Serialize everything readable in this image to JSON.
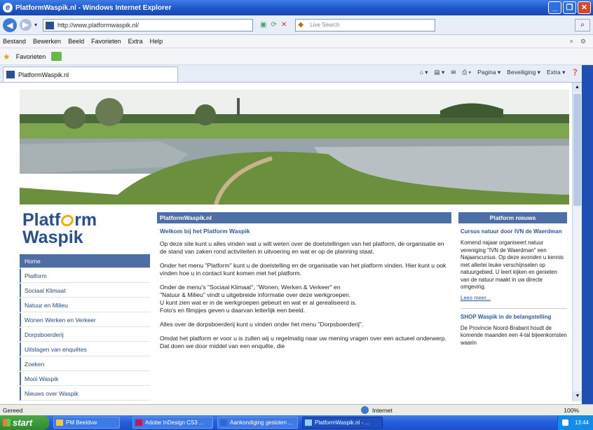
{
  "window": {
    "title": "PlatformWaspik.nl - Windows Internet Explorer",
    "buttons": [
      "_",
      "❐",
      "✕"
    ]
  },
  "address_bar": {
    "url": "http://www.platformwaspik.nl/",
    "search_placeholder": "Live Search"
  },
  "menu": [
    "Bestand",
    "Bewerken",
    "Beeld",
    "Favorieten",
    "Extra",
    "Help"
  ],
  "favorites_label": "Favorieten",
  "tab": {
    "label": "PlatformWaspik.nl"
  },
  "command_bar": [
    "Pagina ▾",
    "Beveiliging ▾",
    "Extra ▾"
  ],
  "site": {
    "logo": {
      "line1": "Platf",
      "line1b": "rm",
      "line2": "Waspik"
    },
    "nav": [
      {
        "label": "Home",
        "active": true
      },
      {
        "label": "Platform"
      },
      {
        "label": "Sociaal Klimaat"
      },
      {
        "label": "Natuur en Milieu"
      },
      {
        "label": "Wonen Werken en Verkeer"
      },
      {
        "label": "Dorpsboerderij"
      },
      {
        "label": "Uitslagen van enquêtes"
      },
      {
        "label": "Zoeken"
      },
      {
        "label": "Mooi Waspik"
      },
      {
        "label": "Nieuws over Waspik"
      }
    ],
    "content": {
      "header": "PlatformWaspik.nl",
      "title": "Welkom bij het Platform Waspik",
      "paragraphs": [
        "Op deze site kunt u alles vinden wat u wilt weten over de doelstellingen van het platform, de organisatie en de stand van zaken rond activiteiten in uitvoering en wat er op de planning staat.",
        "Onder het menu \"Platform\" kunt u de doelstelling en de organisatie van het platform vinden. Hier kunt u ook vinden hoe u in contact kunt komen met het platform.",
        "Onder de menu's \"Sociaal Klimaat\",  \"Wonen, Werken & Verkeer\" en\n\"Natuur & Milieu\" vindt u uitgebreide informatie over deze werkgroepen.\nU kunt zien wat er in de werkgroepen gebeurt en wat er al gerealiseerd is.\nFoto's en filmpjes geven u daarvan letterlijk een beeld.",
        "Alles over de dorpsboerderij kunt u vinden onder het menu \"Dorpsboerderij\".",
        "Omdat het platform er voor u is zullen wij u regelmatig naar uw mening vragen over een actueel onderwerp. Dat doen we door middel van een enquête, die"
      ]
    },
    "sidebar": {
      "header": "Platform nieuws",
      "items": [
        {
          "title": "Cursus natuur door IVN de Waerdman",
          "text": "Komend najaar organiseert natuur vereniging \"IVN de Waerdman\" een Najaarscursus. Op deze avonden u kennis met allerlei leuke verschijnselen op natuurgebied. U leert kijken en genieten van de natuur maakt in uw directe omgeving.",
          "more": "Lees meer..."
        },
        {
          "title": "SHOP Waspik in de belangstelling",
          "text": "De Provincie Noord-Brabant houdt de komende maanden een 4-tal bijeenkomsten waarin"
        }
      ]
    }
  },
  "status_bar": {
    "left": "Gereed",
    "zone": "Internet",
    "zoom": "100%"
  },
  "taskbar": {
    "start": "start",
    "tasks": [
      "PM Beeldvw",
      "Adobe InDesign CS3 ...",
      "Aankondiging gesloten ...",
      "PlatformWaspik.nl - ..."
    ],
    "clock": "13:44"
  },
  "colors": {
    "brand_blue": "#4e6fa6",
    "logo_blue": "#2a4f8f",
    "logo_accent": "#f0b000"
  }
}
